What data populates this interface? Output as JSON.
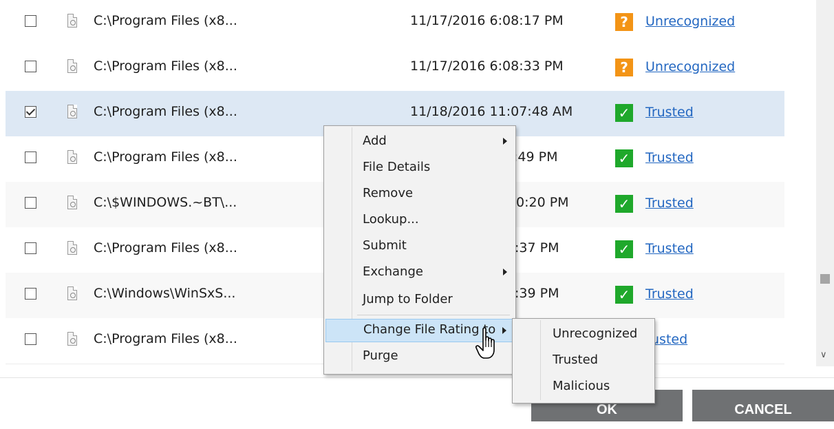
{
  "rows": [
    {
      "path": "C:\\Program Files (x8...",
      "date": "11/17/2016 6:08:17 PM",
      "rating": "Unrecognized",
      "rating_icon": "?",
      "checked": false
    },
    {
      "path": "C:\\Program Files (x8...",
      "date": "11/17/2016 6:08:33 PM",
      "rating": "Unrecognized",
      "rating_icon": "?",
      "checked": false
    },
    {
      "path": "C:\\Program Files (x8...",
      "date": "11/18/2016 11:07:48 AM",
      "rating": "Trusted",
      "rating_icon": "✓",
      "checked": true
    },
    {
      "path": "C:\\Program Files (x8...",
      "date": ":49 PM",
      "rating": "Trusted",
      "rating_icon": "✓",
      "checked": false
    },
    {
      "path": "C:\\$WINDOWS.~BT\\...",
      "date": "0:20 PM",
      "rating": "Trusted",
      "rating_icon": "✓",
      "checked": false
    },
    {
      "path": "C:\\Program Files (x8...",
      "date": ":37 PM",
      "rating": "Trusted",
      "rating_icon": "✓",
      "checked": false
    },
    {
      "path": "C:\\Windows\\WinSxS...",
      "date": ":39 PM",
      "rating": "Trusted",
      "rating_icon": "✓",
      "checked": false
    },
    {
      "path": "C:\\Program Files (x8...",
      "date": "",
      "rating": "usted",
      "rating_icon": "",
      "checked": false
    }
  ],
  "context_menu": {
    "items": [
      "Add",
      "File Details",
      "Remove",
      "Lookup...",
      "Submit",
      "Exchange",
      "Jump to Folder",
      "Change File Rating to",
      "Purge"
    ],
    "submenu_items": [
      "Unrecognized",
      "Trusted",
      "Malicious"
    ]
  },
  "buttons": {
    "ok": "OK",
    "cancel": "CANCEL"
  },
  "colors": {
    "trusted": "#1fa82b",
    "unrecognized": "#f39416",
    "link": "#2367c1",
    "selection": "#dde8f4",
    "button": "#6f7173"
  }
}
